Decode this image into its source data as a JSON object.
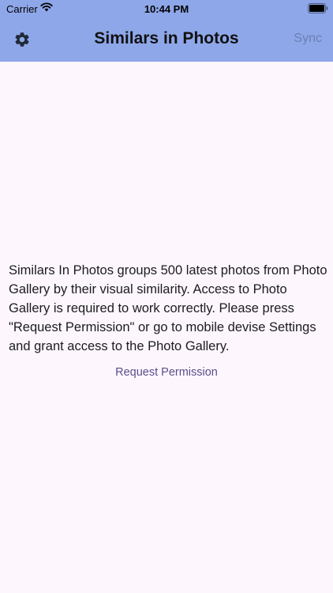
{
  "status_bar": {
    "carrier": "Carrier",
    "time": "10:44 PM",
    "wifi_icon": "wifi-icon",
    "battery_icon": "battery-icon"
  },
  "app_bar": {
    "title": "Similars in Photos",
    "settings_icon": "gear-icon",
    "sync_label": "Sync",
    "background_color": "#8ea7e9"
  },
  "content": {
    "message": "Similars In Photos groups 500 latest photos from Photo Gallery by their visual similarity. Access to Photo Gallery is required to work correctly. Please press \"Request Permission\" or go to mobile devise Settings and grant access to the Photo Gallery.",
    "permission_button_label": "Request Permission",
    "background_color": "#fdf7fd"
  }
}
